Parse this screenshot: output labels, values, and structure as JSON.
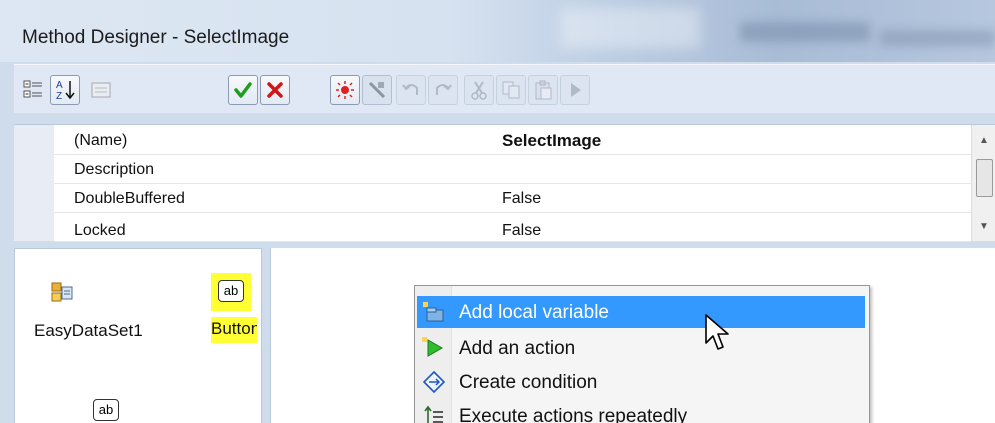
{
  "window": {
    "title": "Method Designer - SelectImage"
  },
  "toolbar": {
    "buttons": [
      {
        "name": "categorized-icon"
      },
      {
        "name": "sort-alphabetical-icon"
      },
      {
        "name": "property-pages-icon"
      },
      {
        "name": "ok-check-icon"
      },
      {
        "name": "cancel-x-icon"
      },
      {
        "name": "debug-icon"
      },
      {
        "name": "delete-icon"
      },
      {
        "name": "undo-icon"
      },
      {
        "name": "redo-icon"
      },
      {
        "name": "cut-icon"
      },
      {
        "name": "copy-icon"
      },
      {
        "name": "paste-icon"
      },
      {
        "name": "run-icon"
      }
    ]
  },
  "properties": {
    "rows": [
      {
        "name": "(Name)",
        "value": "SelectImage"
      },
      {
        "name": "Description",
        "value": ""
      },
      {
        "name": "DoubleBuffered",
        "value": "False"
      },
      {
        "name": "Locked",
        "value": "False"
      }
    ]
  },
  "components": {
    "dataset_label": "EasyDataSet1",
    "button_label": "Button",
    "ab_icon_text": "ab"
  },
  "context_menu": {
    "items": [
      {
        "label": "Add local variable",
        "icon": "add-variable-icon"
      },
      {
        "label": "Add an action",
        "icon": "green-arrow-icon"
      },
      {
        "label": "Create condition",
        "icon": "condition-diamond-icon"
      },
      {
        "label": "Execute actions repeatedly",
        "icon": "loop-icon"
      }
    ]
  },
  "colors": {
    "selection": "#3399ff",
    "highlight": "#ffff33"
  }
}
